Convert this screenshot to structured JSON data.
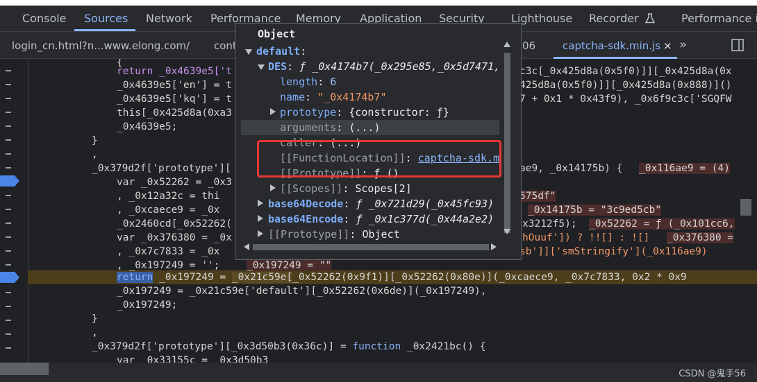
{
  "tabs": [
    "Console",
    "Sources",
    "Network",
    "Performance",
    "Memory",
    "Application",
    "Security",
    "Lighthouse",
    "Recorder",
    "Performance in"
  ],
  "recorder_icon": "flask-icon",
  "file_tabs": {
    "tab1": "login_cn.html?n...www.elong.com/",
    "tab2": "cont",
    "tab3_tail": "06",
    "active": "captcha-sdk.min.js",
    "close": "×",
    "more": "»"
  },
  "code": {
    "l1": "{",
    "l2a": "return _0x4639e5['t",
    "l2b": "c3c[_0x425d8a(0x5f0)]][_0x425d8a(0x",
    "l3a": "_0x4639e5['en'] = t",
    "l3b": "425d8a(0x5f0)]][_0x425d8a(0x888)]()",
    "l4a": "_0x4639e5['kq'] = t",
    "l4b": "7 + 0x1 * 0x43f9), _0x6f9c3c['SGQFW",
    "l5a": "this[_0x425d8a(0xa3",
    "l6": "_0x4639e5;",
    "l7": "}",
    "l8": ",",
    "l9a": "_0x379d2f['prototype'][",
    "l9b": "ae9, _0x14175b) {",
    "l9c": "_0x116ae9 = (4)",
    "l10a": "var _0x52262 = _0x3",
    "l11a": ", _0x12a32c = thi",
    "l11b": "575df\"",
    "l12a": ", _0xcaece9 = _0x",
    "l12b": "_0x14175b = \"3c9ed5cb\"",
    "l13a": "_0x2460cd[_0x52262(",
    "l13b": "x3212f5);",
    "l13c": "_0x52262 = ƒ (_0x101cc6,",
    "l14a": "var _0x376380 = _0x",
    "l14b": "hOuuf']) ? !![] : ![]",
    "l14c": "_0x376380 =",
    "l15a": ", _0x7c7833 = _0x",
    "l15b": "sb']]['smStringify'](_0x116ae9)",
    "l16a": ", _0x197249 = '';",
    "l16b": "_0x197249 = \"\"",
    "l17a": "return",
    "l17b": " _0x197249 = ",
    "l17c": "_0x21c59e[",
    "l17d": "_0x52262(0x9f1)][",
    "l17e": "_0x52262(0x80e)]",
    "l17f": "(_0xcaece9, _0x7c7833, 0x2 * 0x9",
    "l18": "_0x197249 = _0x21c59e['default'][_0x52262(0x6de)](_0x197249),",
    "l19": "_0x197249;",
    "l20": "}",
    "l21": ",",
    "l22a": "_0x379d2f['prototype'][_0x3d50b3(0x36c)] = ",
    "l22b": "function",
    "l22c": " _0x2421bc() {",
    "l23": "var _0x33155c = _0x3d50b3"
  },
  "popover": {
    "title": "Object",
    "default_key": "default",
    "des_key": "DES",
    "des_val": "ƒ _0x4174b7(_0x295e85,_0x5d7471,",
    "length_key": "length",
    "length_val": "6",
    "name_key": "name",
    "name_val": "\"_0x4174b7\"",
    "prototype_key": "prototype",
    "prototype_val": "{constructor: ƒ}",
    "arguments_key": "arguments",
    "arguments_val": "(...)",
    "caller_key": "caller",
    "caller_val": "(...)",
    "funcloc_key": "[[FunctionLocation]]",
    "funcloc_val": "captcha-sdk.m",
    "proto2_key": "[[Prototype]]",
    "proto2_val": "ƒ ()",
    "scopes_key": "[[Scopes]]",
    "scopes_val": "Scopes[2]",
    "b64d_key": "base64Decode",
    "b64d_val": "ƒ _0x721d29(_0x45fc93)",
    "b64e_key": "base64Encode",
    "b64e_val": "ƒ _0x1c377d(_0x44a2e2)",
    "proto3_key": "[[Prototype]]",
    "proto3_val": "Object"
  },
  "watermark": "CSDN @鬼手56",
  "colors": {
    "accent": "#8ab4f8",
    "highlight_box": "#e53935",
    "paused_line": "#4d3e1b"
  }
}
